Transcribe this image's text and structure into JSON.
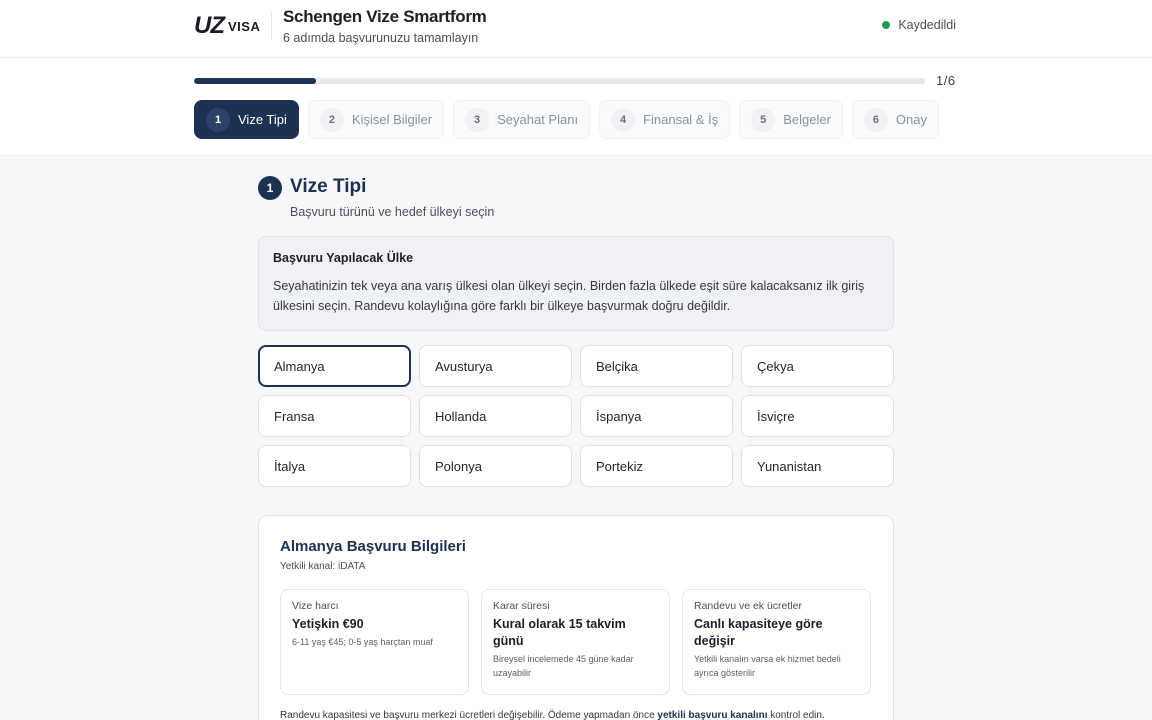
{
  "header": {
    "logo_mark": "UZ",
    "logo_text": "VISA",
    "title": "Schengen Vize Smartform",
    "subtitle": "6 adımda başvurunuzu tamamlayın",
    "save_status": "Kaydedildi",
    "save_color": "#1e9b4e"
  },
  "progress": {
    "label": "1/6",
    "fraction": 0.1667
  },
  "steps": [
    {
      "num": "1",
      "label": "Vize Tipi",
      "active": true
    },
    {
      "num": "2",
      "label": "Kişisel Bilgiler",
      "active": false
    },
    {
      "num": "3",
      "label": "Seyahat Planı",
      "active": false
    },
    {
      "num": "4",
      "label": "Finansal & İş",
      "active": false
    },
    {
      "num": "5",
      "label": "Belgeler",
      "active": false
    },
    {
      "num": "6",
      "label": "Onay",
      "active": false
    }
  ],
  "section": {
    "num": "1",
    "title": "Vize Tipi",
    "subtitle": "Başvuru türünü ve hedef ülkeyi seçin"
  },
  "info": {
    "title": "Başvuru Yapılacak Ülke",
    "text": "Seyahatinizin tek veya ana varış ülkesi olan ülkeyi seçin. Birden fazla ülkede eşit süre kalacaksanız ilk giriş ülkesini seçin. Randevu kolaylığına göre farklı bir ülkeye başvurmak doğru değildir."
  },
  "countries": [
    "Almanya",
    "Avusturya",
    "Belçika",
    "Çekya",
    "Fransa",
    "Hollanda",
    "İspanya",
    "İsviçre",
    "İtalya",
    "Polonya",
    "Portekiz",
    "Yunanistan"
  ],
  "selected_country": "Almanya",
  "detail": {
    "title": "Almanya Başvuru Bilgileri",
    "subtitle": "Yetkili kanal: iDATA",
    "facts": [
      {
        "label": "Vize harcı",
        "value": "Yetişkin €90",
        "note": "6-11 yaş €45; 0-5 yaş harçtan muaf"
      },
      {
        "label": "Karar süresi",
        "value": "Kural olarak 15 takvim günü",
        "note": "Bireysel incelemede 45 güne kadar uzayabilir"
      },
      {
        "label": "Randevu ve ek ücretler",
        "value": "Canlı kapasiteye göre değişir",
        "note": "Yetkili kanalın varsa ek hizmet bedeli ayrıca gösterilir"
      }
    ],
    "foot_before": "Randevu kapasitesi ve başvuru merkezi ücretleri değişebilir. Ödeme yapmadan önce ",
    "foot_link": "yetkili başvuru kanalını",
    "foot_after": " kontrol edin."
  }
}
